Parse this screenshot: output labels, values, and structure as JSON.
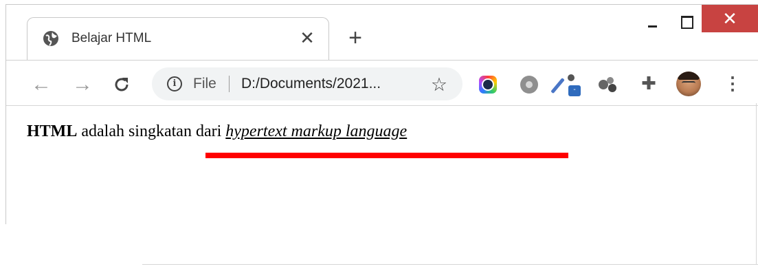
{
  "tab": {
    "title": "Belajar HTML",
    "close_glyph": "✕",
    "icon": "globe-icon"
  },
  "new_tab_glyph": "+",
  "window_controls": {
    "minimize": "minimize-icon",
    "maximize": "maximize-icon",
    "close_glyph": "✕",
    "close_color": "#c84341"
  },
  "toolbar": {
    "back_glyph": "←",
    "forward_glyph": "→",
    "reload_glyph": "C",
    "info_glyph": "i",
    "scheme": "File",
    "url": "D:/Documents/2021...",
    "star_glyph": "☆",
    "puzzle_glyph": "✚",
    "menu_glyph": "⋮",
    "extensions": [
      "lens-icon",
      "gear-icon",
      "eyedropper-icon",
      "molecule-icon",
      "puzzle-icon"
    ],
    "dropper_badge": "-"
  },
  "page": {
    "bold": "HTML",
    "middle": " adalah singkatan dari ",
    "italic_link": "hypertext markup language",
    "highlight_color": "#ff0000"
  }
}
